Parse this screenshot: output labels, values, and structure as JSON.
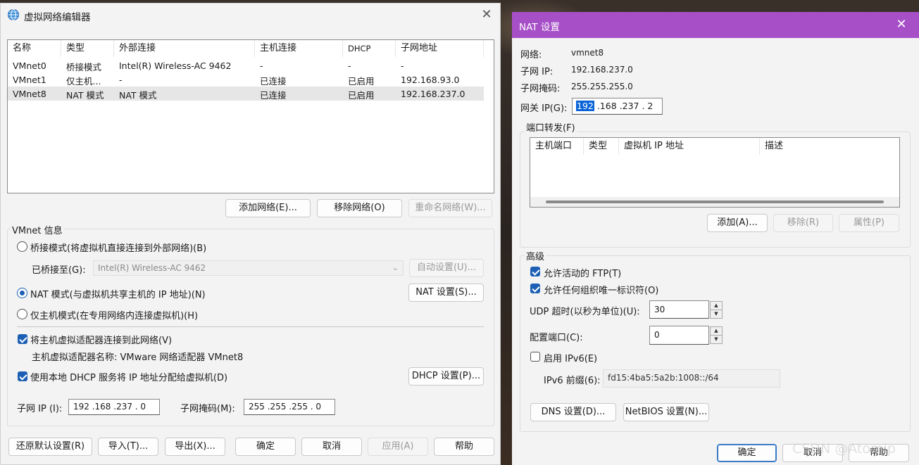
{
  "left": {
    "title": "虚拟网络编辑器",
    "columns": [
      "名称",
      "类型",
      "外部连接",
      "主机连接",
      "DHCP",
      "子网地址"
    ],
    "rows": [
      [
        "VMnet0",
        "桥接模式",
        "Intel(R) Wireless-AC 9462",
        "-",
        "-",
        "-"
      ],
      [
        "VMnet1",
        "仅主机...",
        "-",
        "已连接",
        "已启用",
        "192.168.93.0"
      ],
      [
        "VMnet8",
        "NAT 模式",
        "NAT 模式",
        "已连接",
        "已启用",
        "192.168.237.0"
      ]
    ],
    "add_network": "添加网络(E)...",
    "remove_network": "移除网络(O)",
    "rename_network": "重命名网络(W)...",
    "vmnet_info": "VMnet 信息",
    "bridged_mode": "桥接模式(将虚拟机直接连接到外部网络)(B)",
    "bridged_to_label": "已桥接至(G):",
    "bridged_to_value": "Intel(R) Wireless-AC 9462",
    "auto_settings": "自动设置(U)...",
    "nat_mode": "NAT 模式(与虚拟机共享主机的 IP 地址)(N)",
    "nat_settings": "NAT 设置(S)...",
    "host_only_mode": "仅主机模式(在专用网络内连接虚拟机)(H)",
    "connect_adapter": "将主机虚拟适配器连接到此网络(V)",
    "adapter_name": "主机虚拟适配器名称: VMware 网络适配器 VMnet8",
    "use_dhcp": "使用本地 DHCP 服务将 IP 地址分配给虚拟机(D)",
    "dhcp_settings": "DHCP 设置(P)...",
    "subnet_ip_label": "子网 IP (I):",
    "subnet_ip_value": "192 .168 .237 . 0",
    "subnet_mask_label": "子网掩码(M):",
    "subnet_mask_value": "255 .255 .255 . 0",
    "restore_defaults": "还原默认设置(R)",
    "import": "导入(T)...",
    "export": "导出(X)...",
    "ok": "确定",
    "cancel": "取消",
    "apply": "应用(A)",
    "help": "帮助",
    "selected_mode": "nat"
  },
  "right": {
    "title": "NAT 设置",
    "network_label": "网络:",
    "network_value": "vmnet8",
    "subnet_ip_label": "子网 IP:",
    "subnet_ip_value": "192.168.237.0",
    "subnet_mask_label": "子网掩码:",
    "subnet_mask_value": "255.255.255.0",
    "gateway_label": "网关 IP(G):",
    "gateway_selected": "192",
    "gateway_rest": " .168 .237 . 2",
    "port_forwarding": "端口转发(F)",
    "pf_columns": [
      "主机端口",
      "类型",
      "虚拟机 IP 地址",
      "描述"
    ],
    "add": "添加(A)...",
    "remove": "移除(R)",
    "properties": "属性(P)",
    "advanced": "高级",
    "allow_ftp": "允许活动的 FTP(T)",
    "allow_org_id": "允许任何组织唯一标识符(O)",
    "udp_timeout_label": "UDP 超时(以秒为单位)(U):",
    "udp_timeout_value": "30",
    "config_port_label": "配置端口(C):",
    "config_port_value": "0",
    "enable_ipv6": "启用 IPv6(E)",
    "ipv6_prefix_label": "IPv6 前缀(6):",
    "ipv6_prefix_value": "fd15:4ba5:5a2b:1008::/64",
    "dns_settings": "DNS 设置(D)...",
    "netbios_settings": "NetBIOS 设置(N)...",
    "ok": "确定",
    "cancel": "取消",
    "help": "帮助"
  },
  "watermark": "CSDN @Atomip",
  "colors": {
    "titlebar_right": "#a64fc7",
    "accent": "#1c5fb4",
    "selection": "#0a64d8"
  }
}
